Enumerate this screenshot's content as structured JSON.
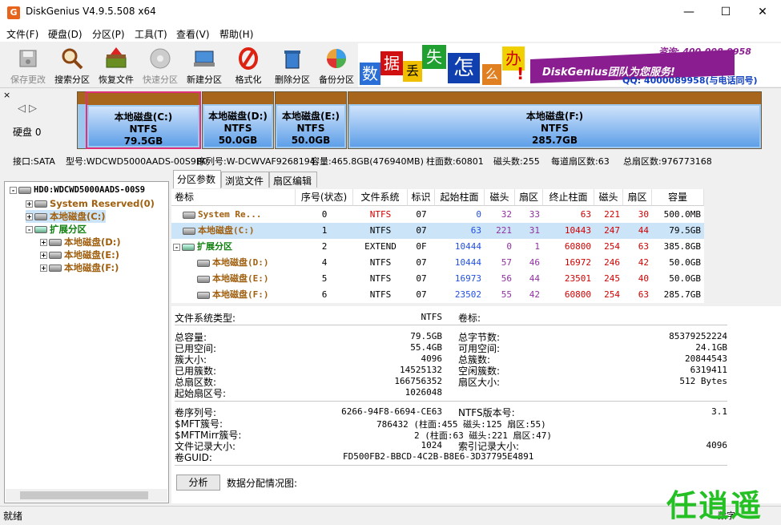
{
  "window": {
    "title": "DiskGenius V4.9.5.508 x64",
    "app_icon": "G",
    "minimize": "—",
    "maximize": "☐",
    "close": "✕"
  },
  "menu": [
    "文件(F)",
    "硬盘(D)",
    "分区(P)",
    "工具(T)",
    "查看(V)",
    "帮助(H)"
  ],
  "toolbar": [
    {
      "label": "保存更改",
      "icon": "save-icon",
      "enabled": false
    },
    {
      "label": "搜索分区",
      "icon": "magnifier-icon",
      "enabled": true
    },
    {
      "label": "恢复文件",
      "icon": "restore-icon",
      "enabled": true
    },
    {
      "label": "快速分区",
      "icon": "quick-partition-icon",
      "enabled": false
    },
    {
      "label": "新建分区",
      "icon": "new-partition-icon",
      "enabled": true
    },
    {
      "label": "格式化",
      "icon": "format-icon",
      "enabled": true
    },
    {
      "label": "删除分区",
      "icon": "delete-icon",
      "enabled": true
    },
    {
      "label": "备份分区",
      "icon": "backup-icon",
      "enabled": true
    }
  ],
  "ad": {
    "chars": [
      "数",
      "据",
      "丢",
      "失",
      "怎",
      "么",
      "办",
      "!"
    ],
    "brand": "DiskGenius团队为您服务!",
    "phone": "咨询: 400-008-9958",
    "qq": "QQ: 4000089958(与电话同号)"
  },
  "diskbar": {
    "disk_label": "硬盘 0",
    "close": "×",
    "nav_left": "◁",
    "nav_right": "▷",
    "partitions": [
      {
        "name": "本地磁盘(C:)",
        "fs": "NTFS",
        "size": "79.5GB"
      },
      {
        "name": "本地磁盘(D:)",
        "fs": "NTFS",
        "size": "50.0GB"
      },
      {
        "name": "本地磁盘(E:)",
        "fs": "NTFS",
        "size": "50.0GB"
      },
      {
        "name": "本地磁盘(F:)",
        "fs": "NTFS",
        "size": "285.7GB"
      }
    ]
  },
  "infoline": {
    "port": "接口:SATA",
    "model": "型号:WDCWD5000AADS-00S9B0",
    "serial": "序列号:W-DCWVAF9268194",
    "capacity": "容量:465.8GB(476940MB)",
    "cylinders": "柱面数:60801",
    "heads": "磁头数:255",
    "sectors": "每道扇区数:63",
    "total": "总扇区数:976773168"
  },
  "tree": {
    "root": "HD0:WDCWD5000AADS-00S9",
    "items": [
      {
        "label": "System Reserved(0)",
        "level": 1,
        "exp": "+"
      },
      {
        "label": "本地磁盘(C:)",
        "level": 1,
        "exp": "+"
      },
      {
        "label": "扩展分区",
        "level": 1,
        "exp": "-"
      },
      {
        "label": "本地磁盘(D:)",
        "level": 2,
        "exp": "+"
      },
      {
        "label": "本地磁盘(E:)",
        "level": 2,
        "exp": "+"
      },
      {
        "label": "本地磁盘(F:)",
        "level": 2,
        "exp": "+"
      }
    ],
    "root_exp": "-"
  },
  "tabs": [
    "分区参数",
    "浏览文件",
    "扇区编辑"
  ],
  "table": {
    "headers": [
      "卷标",
      "序号(状态)",
      "文件系统",
      "标识",
      "起始柱面",
      "磁头",
      "扇区",
      "终止柱面",
      "磁头",
      "扇区",
      "容量"
    ],
    "rows": [
      {
        "label": "System Re...",
        "no": "0",
        "fs": "NTFS",
        "id": "07",
        "sc": "0",
        "sh": "32",
        "ss": "33",
        "ec": "63",
        "eh": "221",
        "es": "30",
        "cap": "500.0MB"
      },
      {
        "label": "本地磁盘(C:)",
        "no": "1",
        "fs": "NTFS",
        "id": "07",
        "sc": "63",
        "sh": "221",
        "ss": "31",
        "ec": "10443",
        "eh": "247",
        "es": "44",
        "cap": "79.5GB"
      },
      {
        "label": "扩展分区",
        "no": "2",
        "fs": "EXTEND",
        "id": "0F",
        "sc": "10444",
        "sh": "0",
        "ss": "1",
        "ec": "60800",
        "eh": "254",
        "es": "63",
        "cap": "385.8GB"
      },
      {
        "label": "本地磁盘(D:)",
        "no": "4",
        "fs": "NTFS",
        "id": "07",
        "sc": "10444",
        "sh": "57",
        "ss": "46",
        "ec": "16972",
        "eh": "246",
        "es": "42",
        "cap": "50.0GB"
      },
      {
        "label": "本地磁盘(E:)",
        "no": "5",
        "fs": "NTFS",
        "id": "07",
        "sc": "16973",
        "sh": "56",
        "ss": "44",
        "ec": "23501",
        "eh": "245",
        "es": "40",
        "cap": "50.0GB"
      },
      {
        "label": "本地磁盘(F:)",
        "no": "6",
        "fs": "NTFS",
        "id": "07",
        "sc": "23502",
        "sh": "55",
        "ss": "42",
        "ec": "60800",
        "eh": "254",
        "es": "63",
        "cap": "285.7GB"
      }
    ]
  },
  "details": {
    "fs_type_label": "文件系统类型:",
    "fs_type": "NTFS",
    "vol_label": "卷标:",
    "total_cap_l": "总容量:",
    "total_cap": "79.5GB",
    "total_bytes_l": "总字节数:",
    "total_bytes": "85379252224",
    "used_l": "已用空间:",
    "used": "55.4GB",
    "free_l": "可用空间:",
    "free": "24.1GB",
    "cluster_l": "簇大小:",
    "cluster": "4096",
    "clusters_l": "总簇数:",
    "clusters": "20844543",
    "used_clusters_l": "已用簇数:",
    "used_clusters": "14525132",
    "free_clusters_l": "空闲簇数:",
    "free_clusters": "6319411",
    "sectors_l": "总扇区数:",
    "sectors": "166756352",
    "sector_size_l": "扇区大小:",
    "sector_size": "512 Bytes",
    "start_l": "起始扇区号:",
    "start": "1026048",
    "serial_l": "卷序列号:",
    "serial": "6266-94F8-6694-CE63",
    "ntfs_ver_l": "NTFS版本号:",
    "ntfs_ver": "3.1",
    "mft_l": "$MFT簇号:",
    "mft": "786432 (柱面:455 磁头:125 扇区:55)",
    "mftmirr_l": "$MFTMirr簇号:",
    "mftmirr": "2 (柱面:63 磁头:221 扇区:47)",
    "frs_l": "文件记录大小:",
    "frs": "1024",
    "idx_l": "索引记录大小:",
    "idx": "4096",
    "guid_l": "卷GUID:",
    "guid": "FD500FB2-BBCD-4C2B-B8E6-3D37795E4891",
    "analyze": "分析",
    "dist": "数据分配情况图:"
  },
  "status": {
    "left": "就绪",
    "right": "数字"
  },
  "watermark": "任逍遥"
}
